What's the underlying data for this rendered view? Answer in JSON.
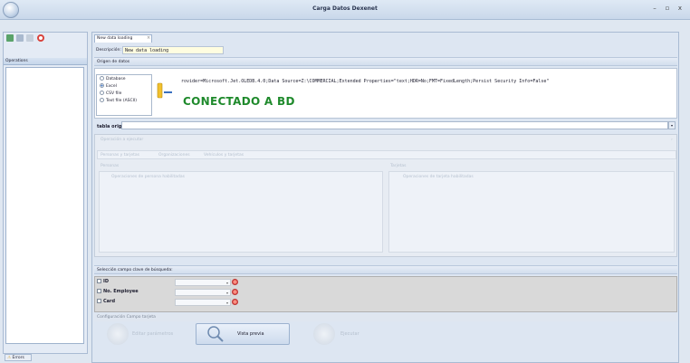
{
  "window": {
    "title": "Carga Datos Dexenet",
    "controls": [
      "–",
      "▫",
      "x"
    ]
  },
  "left": {
    "operations_header": "Operations",
    "errors_button": "Errors"
  },
  "tab": {
    "label": "New data loading"
  },
  "descripcion": {
    "label": "Descripción:",
    "value": "New data loading"
  },
  "origen": {
    "header": "Origen de datos",
    "options": [
      "Database",
      "Excel",
      "CSV file",
      "Text file (ASCII)"
    ],
    "selected_index": 1,
    "connection_string": "rovider=Microsoft.Jet.OLEDB.4.0;Data Source=Z:\\COMMERCIAL;Extended Properties=\"text;HDR=No;FMT=FixedLength;Persist Security Info=False\"",
    "status": "CONECTADO A BD"
  },
  "tabla_origen": {
    "label": "tabla origen:"
  },
  "disabled_section": {
    "header": "Operación a ejecutar",
    "tabs": [
      "Personas y tarjetas",
      "Organizaciones",
      "Vehículos y tarjetas"
    ],
    "left_col": "Personas",
    "right_col": "Tarjetas",
    "left_sub": "Operaciones de persona habilitadas",
    "right_sub": "Operaciones de tarjeta habilitadas"
  },
  "seleccion": {
    "header": "Selección campo clave de búsqueda:",
    "rows": [
      "ID",
      "No. Employee",
      "Card"
    ]
  },
  "configuracion": {
    "header": "Configuración Campo tarjeta"
  },
  "buttons": {
    "left": "Editar parámetros",
    "center": "Vista previa",
    "right": "Ejecutar"
  },
  "colors": {
    "status_green": "#1f8a2c",
    "accent_blue": "#3a70c0"
  }
}
